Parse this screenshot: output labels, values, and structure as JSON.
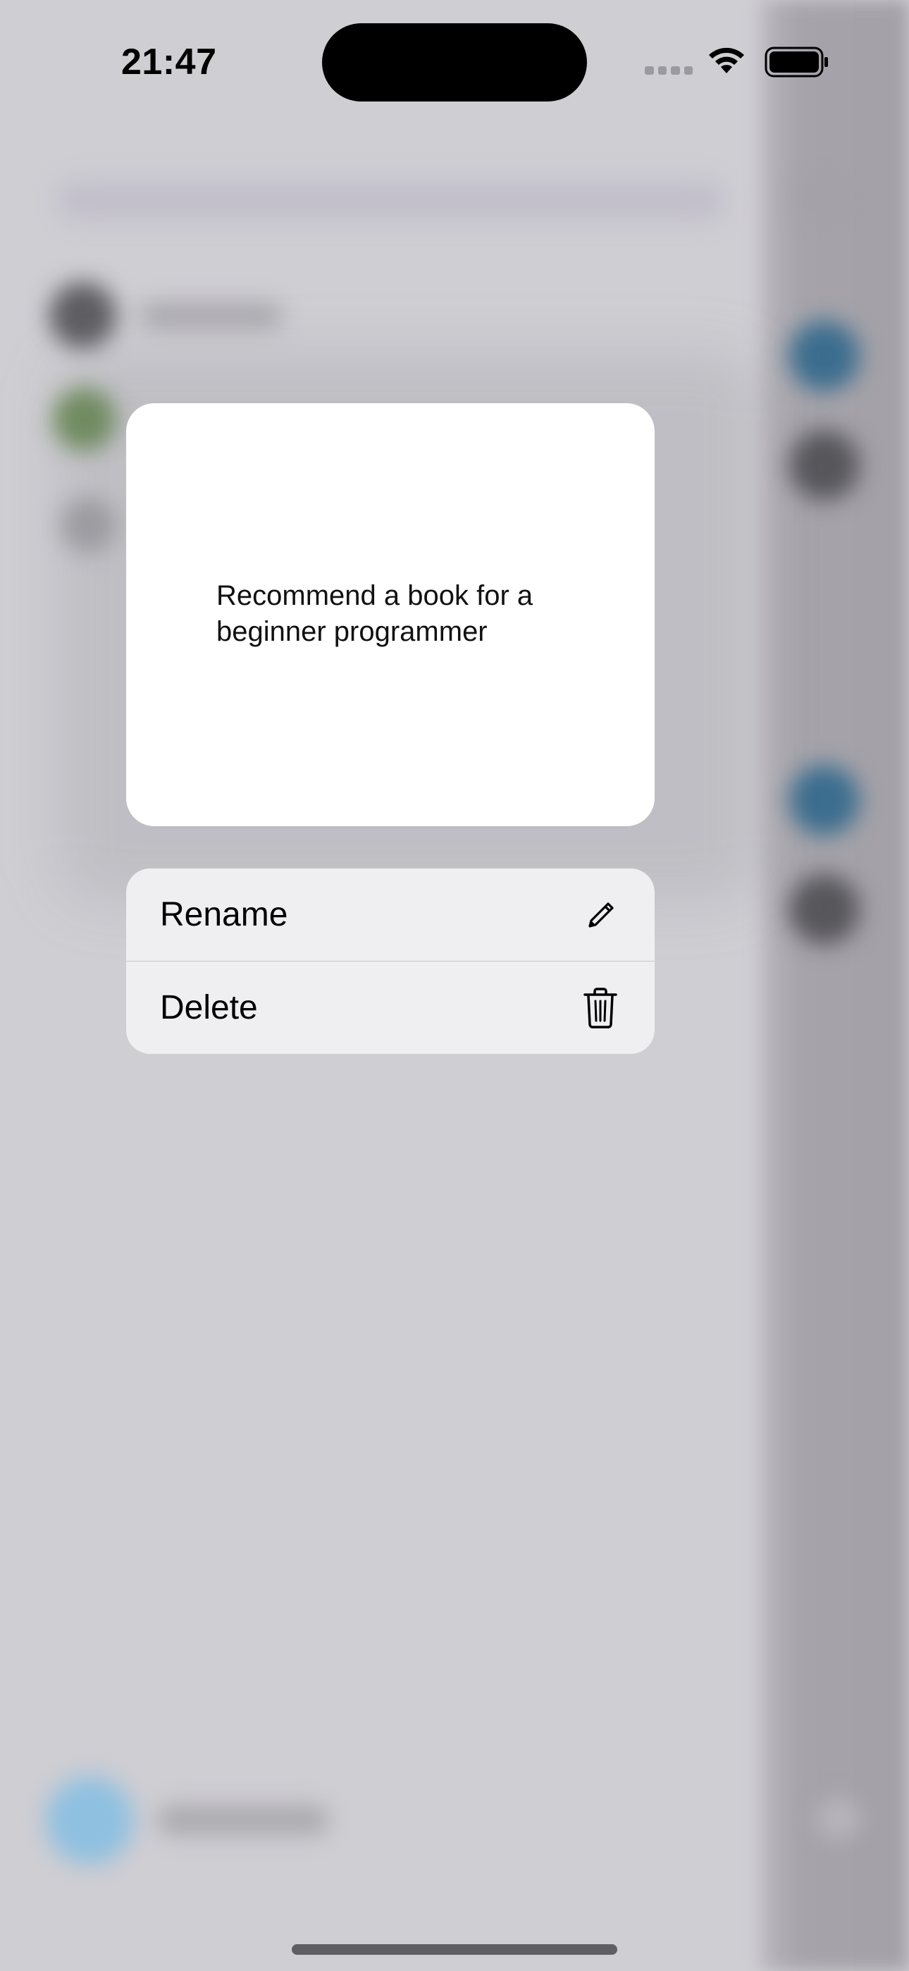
{
  "status_bar": {
    "time": "21:47",
    "icons": [
      "cellular-signal-icon",
      "wifi-icon",
      "battery-icon"
    ]
  },
  "preview": {
    "text": "Recommend a book for a beginner programmer"
  },
  "context_menu": {
    "items": [
      {
        "label": "Rename",
        "icon": "pencil-icon"
      },
      {
        "label": "Delete",
        "icon": "trash-icon"
      }
    ]
  },
  "colors": {
    "backdrop": "#cfced3",
    "card": "#ffffff",
    "menu": "#efeff1",
    "text": "#000000",
    "accent_blue_blur": "#3b6d8f"
  }
}
